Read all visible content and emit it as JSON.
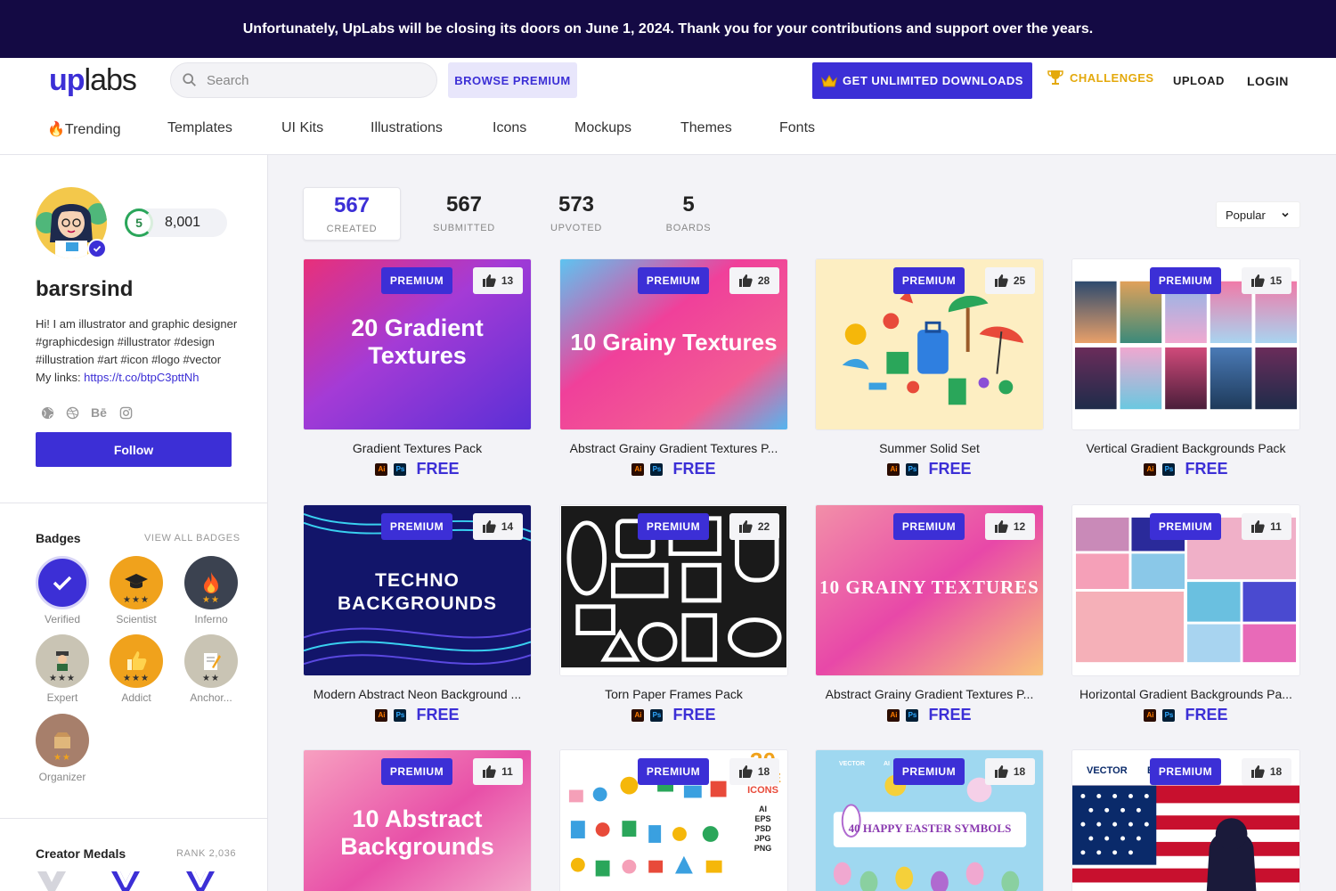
{
  "banner": {
    "text": "Unfortunately, UpLabs will be closing its doors on June 1, 2024. Thank you for your contributions and support over the years."
  },
  "header": {
    "logo_up": "up",
    "logo_labs": "labs",
    "search_placeholder": "Search",
    "browse_premium": "BROWSE PREMIUM",
    "get_unlimited": "GET UNLIMITED DOWNLOADS",
    "challenges": "CHALLENGES",
    "upload": "UPLOAD",
    "login": "LOGIN"
  },
  "nav": {
    "items": [
      "Trending",
      "Templates",
      "UI Kits",
      "Illustrations",
      "Icons",
      "Mockups",
      "Themes",
      "Fonts"
    ],
    "trending_emoji": "🔥"
  },
  "profile": {
    "level": "5",
    "points": "8,001",
    "username": "barsrsind",
    "bio_lines": [
      "Hi! I am illustrator and graphic designer",
      "#graphicdesign #illustrator #design",
      "#illustration #art #icon #logo #vector"
    ],
    "links_label": "My links: ",
    "link_url": "https://t.co/btpC3pttNh",
    "social_behance": "Bē",
    "follow": "Follow"
  },
  "badges": {
    "title": "Badges",
    "view_all": "VIEW ALL BADGES",
    "items": [
      {
        "label": "Verified",
        "stars": "",
        "color": "#3c2fd6"
      },
      {
        "label": "Scientist",
        "stars": "★★★",
        "color": "#f0a21c"
      },
      {
        "label": "Inferno",
        "stars": "★★",
        "color": "#3b4250"
      },
      {
        "label": "Expert",
        "stars": "★★★",
        "color": "#c9c4b4"
      },
      {
        "label": "Addict",
        "stars": "★★★",
        "color": "#f0a21c"
      },
      {
        "label": "Anchor...",
        "stars": "★★",
        "color": "#c9c4b4"
      },
      {
        "label": "Organizer",
        "stars": "★★",
        "color": "#a77f6b"
      }
    ]
  },
  "medals": {
    "title": "Creator Medals",
    "rank": "RANK 2,036"
  },
  "stats": [
    {
      "num": "567",
      "label": "CREATED"
    },
    {
      "num": "567",
      "label": "SUBMITTED"
    },
    {
      "num": "573",
      "label": "UPVOTED"
    },
    {
      "num": "5",
      "label": "BOARDS"
    }
  ],
  "sort": {
    "value": "Popular"
  },
  "card_common": {
    "premium": "PREMIUM",
    "price": "FREE",
    "ai": "Ai",
    "ps": "Ps"
  },
  "cards": [
    {
      "title": "Gradient Textures Pack",
      "likes": "13",
      "overlay": [
        "20 Gradient",
        "Textures"
      ]
    },
    {
      "title": "Abstract Grainy Gradient Textures P...",
      "likes": "28",
      "overlay": [
        "10 Grainy Textures"
      ]
    },
    {
      "title": "Summer Solid Set",
      "likes": "25"
    },
    {
      "title": "Vertical Gradient Backgrounds Pack",
      "likes": "15"
    },
    {
      "title": "Modern Abstract Neon Background ...",
      "likes": "14",
      "overlay": [
        "TECHNO",
        "BACKGROUNDS"
      ]
    },
    {
      "title": "Torn Paper Frames Pack",
      "likes": "22"
    },
    {
      "title": "Abstract Grainy Gradient Textures P...",
      "likes": "12",
      "overlay": [
        "10 GRAINY TEXTURES"
      ]
    },
    {
      "title": "Horizontal Gradient Backgrounds Pa...",
      "likes": "11"
    },
    {
      "title": "",
      "likes": "11",
      "overlay": [
        "10 Abstract",
        "Backgrounds"
      ]
    },
    {
      "title": "",
      "likes": "18",
      "overlay": [
        "30",
        "CUTE",
        "ICONS",
        "AI",
        "EPS",
        "PSD",
        "JPG",
        "PNG"
      ]
    },
    {
      "title": "",
      "likes": "18",
      "overlay": [
        "40 HAPPY EASTER SYMBOLS",
        "VECTOR",
        "AI"
      ]
    },
    {
      "title": "",
      "likes": "18",
      "overlay": [
        "VECTOR",
        "EP"
      ]
    }
  ]
}
